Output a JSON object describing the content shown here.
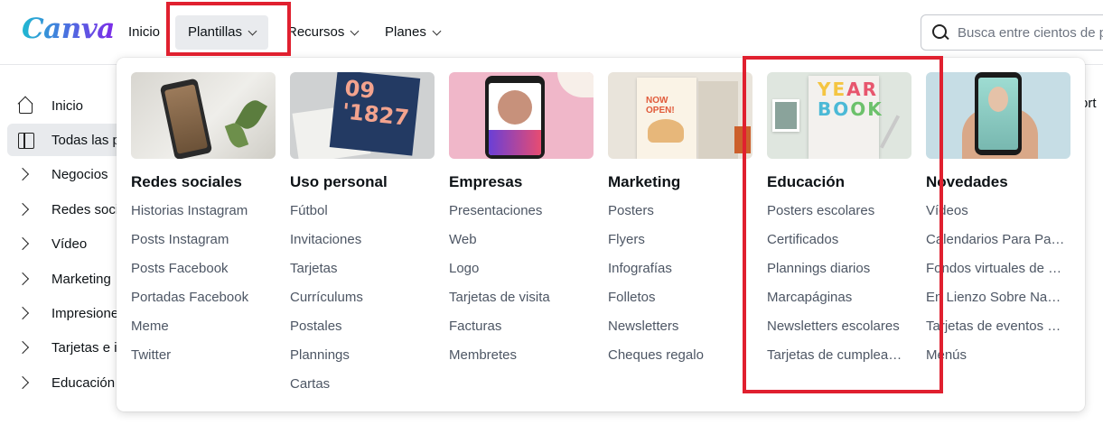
{
  "app": {
    "logo_text": "Canva",
    "accent_color": "#7d2ae8",
    "highlight_color": "#e0202f"
  },
  "header": {
    "nav": [
      {
        "label": "Inicio"
      },
      {
        "label": "Plantillas",
        "icon": "chevron-down-icon"
      },
      {
        "label": "Recursos",
        "icon": "chevron-down-icon"
      },
      {
        "label": "Planes",
        "icon": "chevron-down-icon"
      }
    ],
    "search": {
      "placeholder": "Busca entre cientos de p",
      "icon": "search-icon"
    }
  },
  "sidebar": {
    "items": [
      {
        "label": "Inicio",
        "icon": "home-icon"
      },
      {
        "label": "Todas las p",
        "icon": "templates-grid-icon"
      },
      {
        "label": "Negocios",
        "icon": "chevron-right-icon"
      },
      {
        "label": "Redes soci",
        "icon": "chevron-right-icon"
      },
      {
        "label": "Vídeo",
        "icon": "chevron-right-icon"
      },
      {
        "label": "Marketing",
        "icon": "chevron-right-icon"
      },
      {
        "label": "Impresione",
        "icon": "chevron-right-icon"
      },
      {
        "label": "Tarjetas e i",
        "icon": "chevron-right-icon"
      },
      {
        "label": "Educación",
        "icon": "chevron-right-icon"
      }
    ]
  },
  "right_partial_text": "ort",
  "menu": {
    "columns": [
      {
        "title": "Redes sociales",
        "links": [
          "Historias Instagram",
          "Posts Instagram",
          "Posts Facebook",
          "Portadas Facebook",
          "Meme",
          "Twitter"
        ]
      },
      {
        "title": "Uso personal",
        "thumb_text": "09\n'1827",
        "links": [
          "Fútbol",
          "Invitaciones",
          "Tarjetas",
          "Currículums",
          "Postales",
          "Plannings",
          "Cartas"
        ]
      },
      {
        "title": "Empresas",
        "links": [
          "Presentaciones",
          "Web",
          "Logo",
          "Tarjetas de visita",
          "Facturas",
          "Membretes"
        ]
      },
      {
        "title": "Marketing",
        "thumb_text": "NOW OPEN!",
        "links": [
          "Posters",
          "Flyers",
          "Infografías",
          "Folletos",
          "Newsletters",
          "Cheques regalo"
        ]
      },
      {
        "title": "Educación",
        "thumb_text": "YEARBOOK",
        "links": [
          "Posters escolares",
          "Certificados",
          "Plannings diarios",
          "Marcapáginas",
          "Newsletters escolares",
          "Tarjetas de cumplea…"
        ]
      },
      {
        "title": "Novedades",
        "links": [
          "Vídeos",
          "Calendarios Para Par…",
          "Fondos virtuales de …",
          "En Lienzo Sobre Navi…",
          "Tarjetas de eventos …",
          "Menús"
        ]
      }
    ]
  }
}
